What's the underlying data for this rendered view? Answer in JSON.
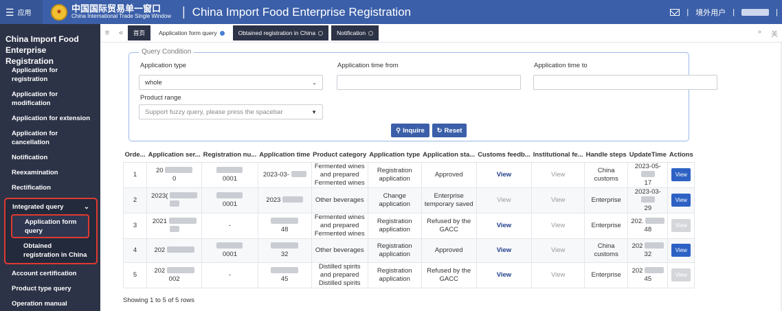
{
  "topbar": {
    "apps_label": "应用",
    "logo_cn": "中国国际贸易单一窗口",
    "logo_en": "China International Trade Single Window",
    "title": "China Import Food Enterprise Registration",
    "user_label": "境外用户"
  },
  "sidebar": {
    "title": "China Import Food Enterprise Registration",
    "items": [
      "Application for registration",
      "Application for modification",
      "Application for extension",
      "Application for cancellation",
      "Notification",
      "Reexamination",
      "Rectification"
    ],
    "group": {
      "label": "Integrated query",
      "subitems": [
        "Application form query",
        "Obtained registration in China"
      ]
    },
    "after_items": [
      "Account certification",
      "Product type query",
      "Operation manual"
    ]
  },
  "tabs": {
    "home": "首页",
    "items": [
      "Application form query",
      "Obtained registration in China",
      "Notification"
    ]
  },
  "query": {
    "legend": "Query Condition",
    "application_type_label": "Application type",
    "application_type_value": "whole",
    "time_from_label": "Application time from",
    "time_to_label": "Application time to",
    "product_range_label": "Product range",
    "product_range_placeholder": "Support fuzzy query, please press the spacebar",
    "inquire_label": "Inquire",
    "reset_label": "Reset"
  },
  "table": {
    "headers": [
      "Orde...",
      "Application ser...",
      "Registration nu...",
      "Application time",
      "Product category",
      "Application type",
      "Application sta...",
      "Customs feedb...",
      "Institutional fe...",
      "Handle steps",
      "UpdateTime",
      "Actions"
    ],
    "rows": [
      {
        "order": "1",
        "serial_a": "20",
        "serial_b": "0",
        "reg": "0001",
        "time": "2023-03-",
        "category": "Fermented wines and prepared Fermented wines",
        "type": "Registration application",
        "status": "Approved",
        "customs": "View",
        "institutional": "View",
        "handle": "China customs",
        "update_a": "2023-05-",
        "update_b": "17",
        "action": "View"
      },
      {
        "order": "2",
        "serial_a": "2023(",
        "serial_b": "",
        "reg": "0001",
        "time": "2023",
        "category": "Other beverages",
        "type": "Change application",
        "status": "Enterprise temporary saved",
        "customs": "View",
        "institutional": "View",
        "handle": "Enterprise",
        "update_a": "2023-03-",
        "update_b": "29",
        "action": "View"
      },
      {
        "order": "3",
        "serial_a": "2021",
        "serial_b": "",
        "reg": "-",
        "time": "48",
        "category": "Fermented wines and prepared Fermented wines",
        "type": "Registration application",
        "status": "Refused by the GACC",
        "customs": "View",
        "institutional": "View",
        "handle": "Enterprise",
        "update_a": "202.",
        "update_b": "48",
        "action": "View"
      },
      {
        "order": "4",
        "serial_a": "202",
        "serial_b": "",
        "reg": "0001",
        "time": "32",
        "category": "Other beverages",
        "type": "Registration application",
        "status": "Approved",
        "customs": "View",
        "institutional": "View",
        "handle": "China customs",
        "update_a": "202",
        "update_b": "32",
        "action": "View"
      },
      {
        "order": "5",
        "serial_a": "202",
        "serial_b": "002",
        "reg": "-",
        "time": "45",
        "category": "Distilled spirits and prepared Distilled spirits",
        "type": "Registration application",
        "status": "Refused by the GACC",
        "customs": "View",
        "institutional": "View",
        "handle": "Enterprise",
        "update_a": "202",
        "update_b": "45",
        "action": "View"
      }
    ]
  },
  "footer_text": "Showing 1 to 5 of 5 rows",
  "colors": {
    "topbar": "#3b5fa8",
    "sidebar": "#2c3347",
    "highlight_border": "#e03a2f",
    "primary_button": "#2d62c4"
  }
}
